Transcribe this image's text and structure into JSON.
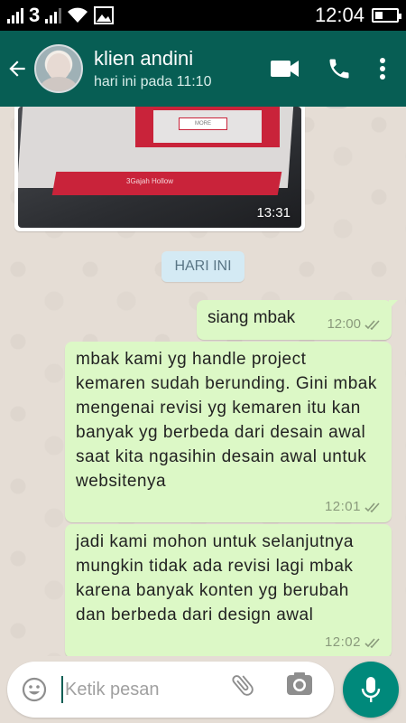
{
  "status_bar": {
    "carrier_glyph": "3",
    "time": "12:04",
    "battery_level": 0.35
  },
  "header": {
    "contact_name": "klien andini",
    "last_seen": "hari ini pada 11:10",
    "icons": [
      "back-arrow-icon",
      "video-call-icon",
      "phone-call-icon",
      "more-options-icon"
    ]
  },
  "chat": {
    "image_message": {
      "time": "13:31",
      "image_button_text": "MORE",
      "image_caption_text": "3Gajah Hollow"
    },
    "date_divider": "HARI INI",
    "messages": [
      {
        "text": "siang mbak",
        "time": "12:00",
        "status": "read"
      },
      {
        "text": "mbak kami yg handle project kemaren sudah berunding. Gini mbak mengenai revisi yg kemaren itu kan banyak yg berbeda dari desain awal saat kita ngasihin desain awal untuk websitenya",
        "time": "12:01",
        "status": "read"
      },
      {
        "text": "jadi kami mohon untuk selanjutnya mungkin tidak ada revisi lagi mbak karena banyak konten yg berubah dan berbeda dari design awal",
        "time": "12:02",
        "status": "read"
      }
    ]
  },
  "composer": {
    "placeholder": "Ketik pesan",
    "value": ""
  },
  "colors": {
    "header": "#075e54",
    "outgoing_bubble": "#dcf8c6",
    "mic_button": "#00897b",
    "chat_bg": "#e5ddd5"
  }
}
